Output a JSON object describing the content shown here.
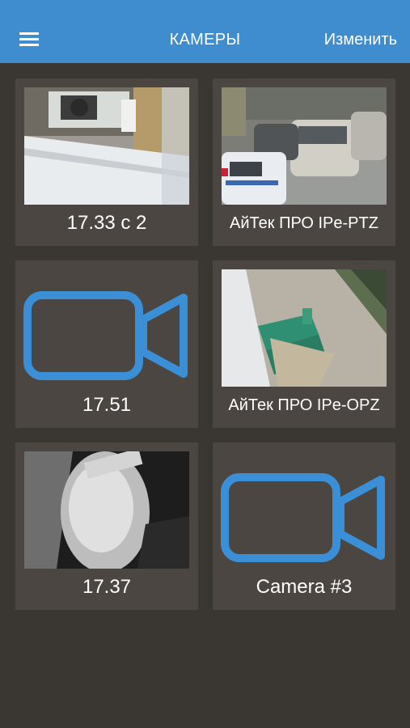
{
  "header": {
    "title": "КАМЕРЫ",
    "edit_label": "Изменить",
    "bg_color": "#3f8ccf"
  },
  "cameras": [
    {
      "name": "17.33 c 2",
      "preview": "snapshot"
    },
    {
      "name": "АйТек ПРО IPe-PTZ",
      "preview": "snapshot"
    },
    {
      "name": "17.51",
      "preview": "camera-icon"
    },
    {
      "name": "АйТек ПРО IPe-OPZ",
      "preview": "snapshot"
    },
    {
      "name": "17.37",
      "preview": "snapshot"
    },
    {
      "name": "Camera #3",
      "preview": "camera-icon"
    }
  ],
  "icons": {
    "menu": "hamburger-icon",
    "placeholder": "video-camera-icon",
    "placeholder_color": "#3a8fd6"
  }
}
